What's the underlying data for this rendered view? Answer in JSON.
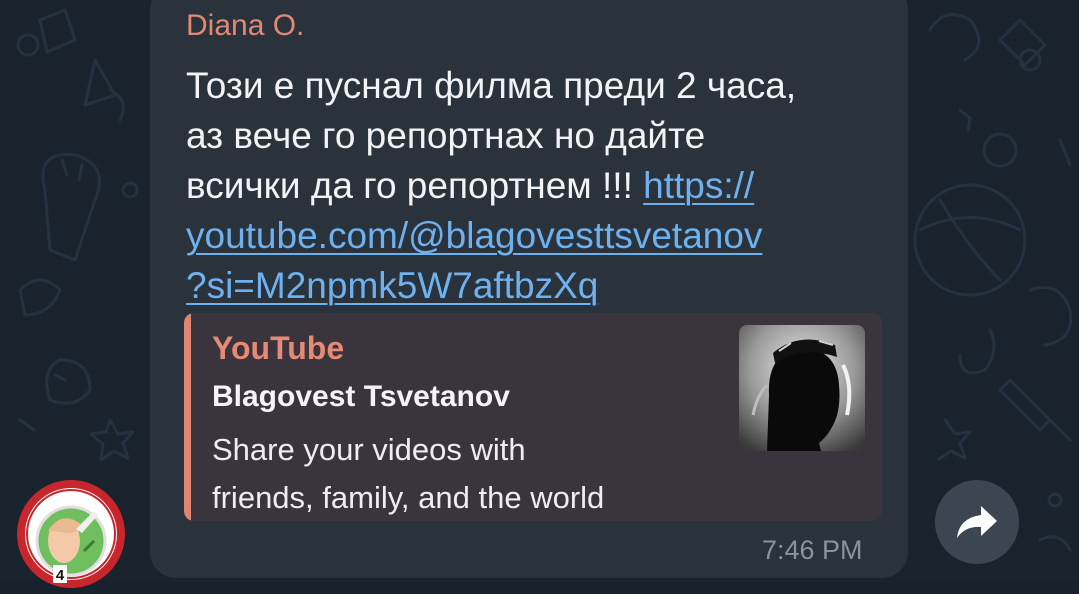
{
  "message": {
    "sender": "Diana O.",
    "text_lines": [
      "Този е пуснал филма преди 2 часа,",
      "аз вече го репортнах но дайте",
      "всички да го репортнем !!! "
    ],
    "link_parts": [
      "https://",
      "youtube.com/@blagovesttsvetanov",
      "?si=M2npmk5W7aftbzXq"
    ],
    "time": "7:46 PM"
  },
  "link_preview": {
    "site_name": "YouTube",
    "title": "Blagovest Tsvetanov",
    "description_lines": [
      "Share your videos with",
      "friends, family, and the world"
    ],
    "thumbnail_icon": "profile-silhouette-icon"
  },
  "avatar": {
    "badge_number": "4",
    "icon": "group-avatar-icon"
  },
  "actions": {
    "forward_icon": "forward-arrow-icon"
  },
  "colors": {
    "background": "#19232e",
    "bubble": "#2a323c",
    "sender": "#e38873",
    "link": "#6fb1ee",
    "preview_accent": "#e08570",
    "time": "#8a929b"
  }
}
